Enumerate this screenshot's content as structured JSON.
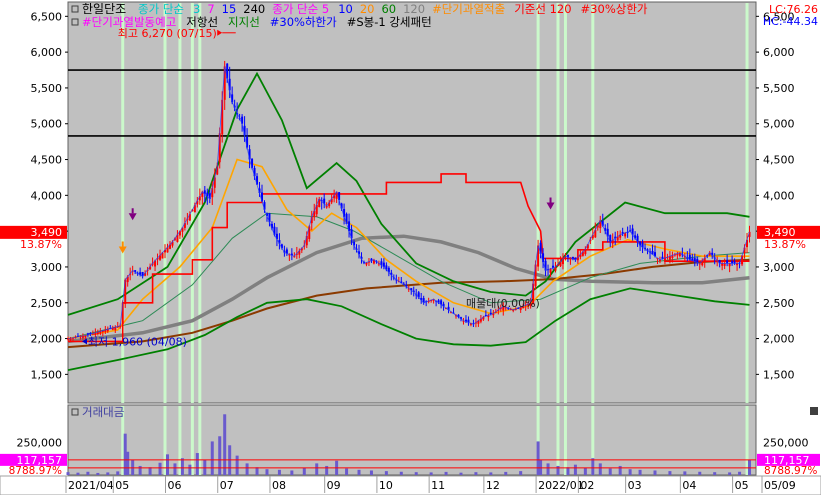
{
  "chart_data": {
    "type": "line",
    "stock_name": "한일단조",
    "legend_line1": [
      {
        "text": "종가 단순",
        "color": "#00c8c8"
      },
      {
        "text": "3",
        "color": "#00c8c8"
      },
      {
        "text": "7",
        "color": "#ff00ff"
      },
      {
        "text": "15",
        "color": "#0000ff"
      },
      {
        "text": "240",
        "color": "#000000"
      },
      {
        "text": "종가 단순 5",
        "color": "#ff00ff"
      },
      {
        "text": "10",
        "color": "#0000ff"
      },
      {
        "text": "20",
        "color": "#ff8c00"
      },
      {
        "text": "60",
        "color": "#008000"
      },
      {
        "text": "120",
        "color": "#808080"
      },
      {
        "text": "#단기과열적출",
        "color": "#ff8c00"
      },
      {
        "text": "기준선 120",
        "color": "#ff0000"
      },
      {
        "text": "#30%상한가",
        "color": "#ff0000"
      }
    ],
    "legend_line2": [
      {
        "text": "#단기과열발동예고",
        "color": "#ff00ff"
      },
      {
        "text": "저항선",
        "color": "#000000"
      },
      {
        "text": "지지선",
        "color": "#008000"
      },
      {
        "text": "#30%하한가",
        "color": "#0000ff"
      },
      {
        "text": "#S봉-1 강세패턴",
        "color": "#000000"
      }
    ],
    "lc_label": "LC:76.26",
    "hc_label": "HC:-44.34",
    "price_axis": {
      "ticks": [
        1500,
        2000,
        2500,
        3000,
        3500,
        4000,
        4500,
        5000,
        5500,
        6000,
        6500
      ],
      "labels": [
        "1,500",
        "2,000",
        "2,500",
        "3,000",
        "3,500",
        "4,000",
        "4,500",
        "5,000",
        "5,500",
        "6,000",
        "6,500"
      ],
      "range": [
        1100,
        6700
      ]
    },
    "current_price": 3490,
    "current_price_label": "3,490",
    "current_change_label": "13.87%",
    "high_annotation": "최고 6,270 (07/15)",
    "low_annotation": "최저 1,960 (04/08)",
    "center_annotation": "매물대(0.00%)",
    "resistance_levels": [
      5750,
      4830
    ],
    "x_axis": {
      "labels": [
        "2021/04",
        "05",
        "06",
        "07",
        "08",
        "09",
        "10",
        "11",
        "12",
        "2022/01",
        "02",
        "03",
        "04",
        "05",
        "05/09"
      ],
      "positions": [
        0,
        19,
        40,
        61,
        82,
        104,
        125,
        146,
        168,
        189,
        206,
        225,
        247,
        268,
        275
      ]
    },
    "num_days": 275,
    "close_series": [
      {
        "d": 0,
        "v": 2000
      },
      {
        "d": 8,
        "v": 2050
      },
      {
        "d": 15,
        "v": 2120
      },
      {
        "d": 21,
        "v": 2180
      },
      {
        "d": 23,
        "v": 2820
      },
      {
        "d": 26,
        "v": 2950
      },
      {
        "d": 30,
        "v": 2870
      },
      {
        "d": 34,
        "v": 3050
      },
      {
        "d": 38,
        "v": 3200
      },
      {
        "d": 42,
        "v": 3350
      },
      {
        "d": 46,
        "v": 3550
      },
      {
        "d": 50,
        "v": 3800
      },
      {
        "d": 54,
        "v": 4050
      },
      {
        "d": 57,
        "v": 3950
      },
      {
        "d": 60,
        "v": 4400
      },
      {
        "d": 63,
        "v": 5800
      },
      {
        "d": 66,
        "v": 5300
      },
      {
        "d": 70,
        "v": 5000
      },
      {
        "d": 73,
        "v": 4500
      },
      {
        "d": 76,
        "v": 4150
      },
      {
        "d": 79,
        "v": 3800
      },
      {
        "d": 83,
        "v": 3450
      },
      {
        "d": 87,
        "v": 3200
      },
      {
        "d": 91,
        "v": 3150
      },
      {
        "d": 95,
        "v": 3300
      },
      {
        "d": 98,
        "v": 3700
      },
      {
        "d": 101,
        "v": 3950
      },
      {
        "d": 104,
        "v": 3850
      },
      {
        "d": 108,
        "v": 4050
      },
      {
        "d": 111,
        "v": 3700
      },
      {
        "d": 115,
        "v": 3300
      },
      {
        "d": 119,
        "v": 3050
      },
      {
        "d": 123,
        "v": 3100
      },
      {
        "d": 127,
        "v": 3000
      },
      {
        "d": 131,
        "v": 2850
      },
      {
        "d": 135,
        "v": 2750
      },
      {
        "d": 139,
        "v": 2650
      },
      {
        "d": 143,
        "v": 2500
      },
      {
        "d": 147,
        "v": 2550
      },
      {
        "d": 151,
        "v": 2450
      },
      {
        "d": 155,
        "v": 2350
      },
      {
        "d": 159,
        "v": 2250
      },
      {
        "d": 163,
        "v": 2200
      },
      {
        "d": 167,
        "v": 2300
      },
      {
        "d": 171,
        "v": 2350
      },
      {
        "d": 175,
        "v": 2450
      },
      {
        "d": 179,
        "v": 2400
      },
      {
        "d": 183,
        "v": 2450
      },
      {
        "d": 186,
        "v": 2500
      },
      {
        "d": 189,
        "v": 3300
      },
      {
        "d": 192,
        "v": 2950
      },
      {
        "d": 196,
        "v": 3000
      },
      {
        "d": 200,
        "v": 3150
      },
      {
        "d": 204,
        "v": 3100
      },
      {
        "d": 208,
        "v": 3250
      },
      {
        "d": 211,
        "v": 3450
      },
      {
        "d": 214,
        "v": 3650
      },
      {
        "d": 218,
        "v": 3350
      },
      {
        "d": 222,
        "v": 3450
      },
      {
        "d": 226,
        "v": 3500
      },
      {
        "d": 230,
        "v": 3300
      },
      {
        "d": 234,
        "v": 3200
      },
      {
        "d": 238,
        "v": 3100
      },
      {
        "d": 242,
        "v": 3150
      },
      {
        "d": 246,
        "v": 3200
      },
      {
        "d": 250,
        "v": 3100
      },
      {
        "d": 254,
        "v": 3050
      },
      {
        "d": 258,
        "v": 3200
      },
      {
        "d": 262,
        "v": 3050
      },
      {
        "d": 266,
        "v": 3050
      },
      {
        "d": 270,
        "v": 3050
      },
      {
        "d": 274,
        "v": 3490
      }
    ],
    "envelope_upper": [
      {
        "d": 0,
        "v": 2330
      },
      {
        "d": 20,
        "v": 2550
      },
      {
        "d": 40,
        "v": 3000
      },
      {
        "d": 55,
        "v": 3900
      },
      {
        "d": 68,
        "v": 5200
      },
      {
        "d": 76,
        "v": 5700
      },
      {
        "d": 86,
        "v": 5050
      },
      {
        "d": 96,
        "v": 4100
      },
      {
        "d": 108,
        "v": 4450
      },
      {
        "d": 116,
        "v": 4200
      },
      {
        "d": 126,
        "v": 3600
      },
      {
        "d": 140,
        "v": 3050
      },
      {
        "d": 155,
        "v": 2800
      },
      {
        "d": 170,
        "v": 2650
      },
      {
        "d": 184,
        "v": 2600
      },
      {
        "d": 192,
        "v": 2800
      },
      {
        "d": 204,
        "v": 3350
      },
      {
        "d": 224,
        "v": 3900
      },
      {
        "d": 240,
        "v": 3750
      },
      {
        "d": 255,
        "v": 3750
      },
      {
        "d": 265,
        "v": 3750
      },
      {
        "d": 274,
        "v": 3700
      }
    ],
    "envelope_lower": [
      {
        "d": 0,
        "v": 1560
      },
      {
        "d": 20,
        "v": 1700
      },
      {
        "d": 40,
        "v": 1850
      },
      {
        "d": 55,
        "v": 2050
      },
      {
        "d": 68,
        "v": 2300
      },
      {
        "d": 80,
        "v": 2500
      },
      {
        "d": 96,
        "v": 2550
      },
      {
        "d": 110,
        "v": 2450
      },
      {
        "d": 126,
        "v": 2200
      },
      {
        "d": 140,
        "v": 2000
      },
      {
        "d": 155,
        "v": 1920
      },
      {
        "d": 170,
        "v": 1900
      },
      {
        "d": 184,
        "v": 1950
      },
      {
        "d": 196,
        "v": 2250
      },
      {
        "d": 210,
        "v": 2550
      },
      {
        "d": 226,
        "v": 2700
      },
      {
        "d": 245,
        "v": 2600
      },
      {
        "d": 260,
        "v": 2520
      },
      {
        "d": 274,
        "v": 2470
      }
    ],
    "ma_gray": [
      {
        "d": 0,
        "v": 1960
      },
      {
        "d": 30,
        "v": 2080
      },
      {
        "d": 50,
        "v": 2250
      },
      {
        "d": 66,
        "v": 2550
      },
      {
        "d": 80,
        "v": 2850
      },
      {
        "d": 100,
        "v": 3200
      },
      {
        "d": 118,
        "v": 3400
      },
      {
        "d": 135,
        "v": 3430
      },
      {
        "d": 150,
        "v": 3350
      },
      {
        "d": 165,
        "v": 3200
      },
      {
        "d": 180,
        "v": 2980
      },
      {
        "d": 195,
        "v": 2830
      },
      {
        "d": 210,
        "v": 2800
      },
      {
        "d": 235,
        "v": 2780
      },
      {
        "d": 255,
        "v": 2780
      },
      {
        "d": 274,
        "v": 2850
      }
    ],
    "ma_brown": [
      {
        "d": 0,
        "v": 1880
      },
      {
        "d": 30,
        "v": 1960
      },
      {
        "d": 50,
        "v": 2080
      },
      {
        "d": 66,
        "v": 2250
      },
      {
        "d": 80,
        "v": 2420
      },
      {
        "d": 100,
        "v": 2600
      },
      {
        "d": 120,
        "v": 2700
      },
      {
        "d": 150,
        "v": 2780
      },
      {
        "d": 175,
        "v": 2800
      },
      {
        "d": 195,
        "v": 2830
      },
      {
        "d": 215,
        "v": 2900
      },
      {
        "d": 235,
        "v": 3000
      },
      {
        "d": 255,
        "v": 3070
      },
      {
        "d": 274,
        "v": 3100
      }
    ],
    "ma_orange": [
      {
        "d": 0,
        "v": 2000
      },
      {
        "d": 20,
        "v": 2120
      },
      {
        "d": 30,
        "v": 2550
      },
      {
        "d": 45,
        "v": 3000
      },
      {
        "d": 58,
        "v": 3550
      },
      {
        "d": 68,
        "v": 4500
      },
      {
        "d": 78,
        "v": 4400
      },
      {
        "d": 88,
        "v": 3800
      },
      {
        "d": 98,
        "v": 3500
      },
      {
        "d": 106,
        "v": 3750
      },
      {
        "d": 116,
        "v": 3550
      },
      {
        "d": 128,
        "v": 3100
      },
      {
        "d": 140,
        "v": 2800
      },
      {
        "d": 155,
        "v": 2500
      },
      {
        "d": 170,
        "v": 2350
      },
      {
        "d": 185,
        "v": 2450
      },
      {
        "d": 195,
        "v": 2800
      },
      {
        "d": 210,
        "v": 3150
      },
      {
        "d": 225,
        "v": 3380
      },
      {
        "d": 240,
        "v": 3250
      },
      {
        "d": 255,
        "v": 3150
      },
      {
        "d": 274,
        "v": 3150
      }
    ],
    "ma_thin_green": [
      {
        "d": 0,
        "v": 2000
      },
      {
        "d": 30,
        "v": 2250
      },
      {
        "d": 50,
        "v": 2750
      },
      {
        "d": 66,
        "v": 3400
      },
      {
        "d": 80,
        "v": 3750
      },
      {
        "d": 100,
        "v": 3700
      },
      {
        "d": 115,
        "v": 3500
      },
      {
        "d": 130,
        "v": 3200
      },
      {
        "d": 150,
        "v": 2800
      },
      {
        "d": 170,
        "v": 2500
      },
      {
        "d": 190,
        "v": 2550
      },
      {
        "d": 210,
        "v": 2850
      },
      {
        "d": 230,
        "v": 3050
      },
      {
        "d": 255,
        "v": 3150
      },
      {
        "d": 274,
        "v": 3200
      }
    ],
    "baseline_red": [
      {
        "d": 0,
        "v": 1960
      },
      {
        "d": 22,
        "v": 1960
      },
      {
        "d": 22,
        "v": 2500
      },
      {
        "d": 34,
        "v": 2500
      },
      {
        "d": 34,
        "v": 2900
      },
      {
        "d": 50,
        "v": 2900
      },
      {
        "d": 50,
        "v": 3100
      },
      {
        "d": 58,
        "v": 3100
      },
      {
        "d": 58,
        "v": 3550
      },
      {
        "d": 64,
        "v": 3550
      },
      {
        "d": 64,
        "v": 3900
      },
      {
        "d": 78,
        "v": 3900
      },
      {
        "d": 78,
        "v": 4020
      },
      {
        "d": 128,
        "v": 4020
      },
      {
        "d": 128,
        "v": 4180
      },
      {
        "d": 150,
        "v": 4180
      },
      {
        "d": 150,
        "v": 4300
      },
      {
        "d": 160,
        "v": 4300
      },
      {
        "d": 160,
        "v": 4180
      },
      {
        "d": 182,
        "v": 4180
      },
      {
        "d": 185,
        "v": 3850
      },
      {
        "d": 190,
        "v": 3500
      },
      {
        "d": 191,
        "v": 3120
      },
      {
        "d": 205,
        "v": 3120
      },
      {
        "d": 205,
        "v": 3240
      },
      {
        "d": 215,
        "v": 3240
      },
      {
        "d": 215,
        "v": 3350
      },
      {
        "d": 240,
        "v": 3350
      },
      {
        "d": 240,
        "v": 3080
      },
      {
        "d": 274,
        "v": 3080
      }
    ],
    "highlight_days": [
      22,
      39,
      45,
      50,
      53,
      189,
      197,
      200,
      211,
      273
    ],
    "purple_markers": [
      {
        "d": 26,
        "v": 3680
      },
      {
        "d": 194,
        "v": 3830
      }
    ],
    "orange_markers": [
      {
        "d": 22,
        "v": 3230
      }
    ],
    "volume": {
      "label": "거래대금",
      "axis_tick_label": "250,000",
      "axis_tick_value": 250000,
      "current_label": "117,157",
      "current_pct_label": "8788.97%",
      "max": 480000,
      "bars": [
        {
          "d": 0,
          "v": 22000
        },
        {
          "d": 4,
          "v": 18000
        },
        {
          "d": 8,
          "v": 25000
        },
        {
          "d": 12,
          "v": 16000
        },
        {
          "d": 16,
          "v": 20000
        },
        {
          "d": 20,
          "v": 28000
        },
        {
          "d": 23,
          "v": 320000
        },
        {
          "d": 24,
          "v": 180000
        },
        {
          "d": 26,
          "v": 120000
        },
        {
          "d": 29,
          "v": 70000
        },
        {
          "d": 33,
          "v": 60000
        },
        {
          "d": 37,
          "v": 95000
        },
        {
          "d": 40,
          "v": 160000
        },
        {
          "d": 43,
          "v": 90000
        },
        {
          "d": 46,
          "v": 130000
        },
        {
          "d": 49,
          "v": 80000
        },
        {
          "d": 52,
          "v": 170000
        },
        {
          "d": 55,
          "v": 120000
        },
        {
          "d": 58,
          "v": 260000
        },
        {
          "d": 61,
          "v": 300000
        },
        {
          "d": 63,
          "v": 470000
        },
        {
          "d": 65,
          "v": 230000
        },
        {
          "d": 68,
          "v": 150000
        },
        {
          "d": 72,
          "v": 90000
        },
        {
          "d": 76,
          "v": 60000
        },
        {
          "d": 80,
          "v": 45000
        },
        {
          "d": 85,
          "v": 40000
        },
        {
          "d": 90,
          "v": 35000
        },
        {
          "d": 95,
          "v": 55000
        },
        {
          "d": 100,
          "v": 90000
        },
        {
          "d": 104,
          "v": 70000
        },
        {
          "d": 108,
          "v": 110000
        },
        {
          "d": 112,
          "v": 50000
        },
        {
          "d": 117,
          "v": 40000
        },
        {
          "d": 122,
          "v": 35000
        },
        {
          "d": 128,
          "v": 30000
        },
        {
          "d": 134,
          "v": 25000
        },
        {
          "d": 140,
          "v": 22000
        },
        {
          "d": 146,
          "v": 20000
        },
        {
          "d": 152,
          "v": 24000
        },
        {
          "d": 158,
          "v": 18000
        },
        {
          "d": 164,
          "v": 22000
        },
        {
          "d": 170,
          "v": 20000
        },
        {
          "d": 176,
          "v": 24000
        },
        {
          "d": 182,
          "v": 30000
        },
        {
          "d": 189,
          "v": 260000
        },
        {
          "d": 190,
          "v": 120000
        },
        {
          "d": 193,
          "v": 90000
        },
        {
          "d": 197,
          "v": 70000
        },
        {
          "d": 201,
          "v": 60000
        },
        {
          "d": 204,
          "v": 80000
        },
        {
          "d": 208,
          "v": 55000
        },
        {
          "d": 211,
          "v": 130000
        },
        {
          "d": 214,
          "v": 90000
        },
        {
          "d": 218,
          "v": 50000
        },
        {
          "d": 222,
          "v": 70000
        },
        {
          "d": 226,
          "v": 45000
        },
        {
          "d": 230,
          "v": 40000
        },
        {
          "d": 236,
          "v": 35000
        },
        {
          "d": 242,
          "v": 30000
        },
        {
          "d": 248,
          "v": 28000
        },
        {
          "d": 254,
          "v": 25000
        },
        {
          "d": 260,
          "v": 22000
        },
        {
          "d": 266,
          "v": 20000
        },
        {
          "d": 270,
          "v": 25000
        },
        {
          "d": 274,
          "v": 117157
        }
      ]
    },
    "colors": {
      "background": "#c0c0c0",
      "envelope": "#008000",
      "ma_gray": "#808080",
      "ma_brown": "#8b3a00",
      "ma_orange": "#ffa500",
      "ma_thin_green": "#2e8b57",
      "baseline": "#ff0000",
      "candle": "#0000ff",
      "resistance": "#000000",
      "highlight": "#ccffcc",
      "volume_bar": "#6a5acd",
      "price_tag": "#ff0000"
    }
  }
}
